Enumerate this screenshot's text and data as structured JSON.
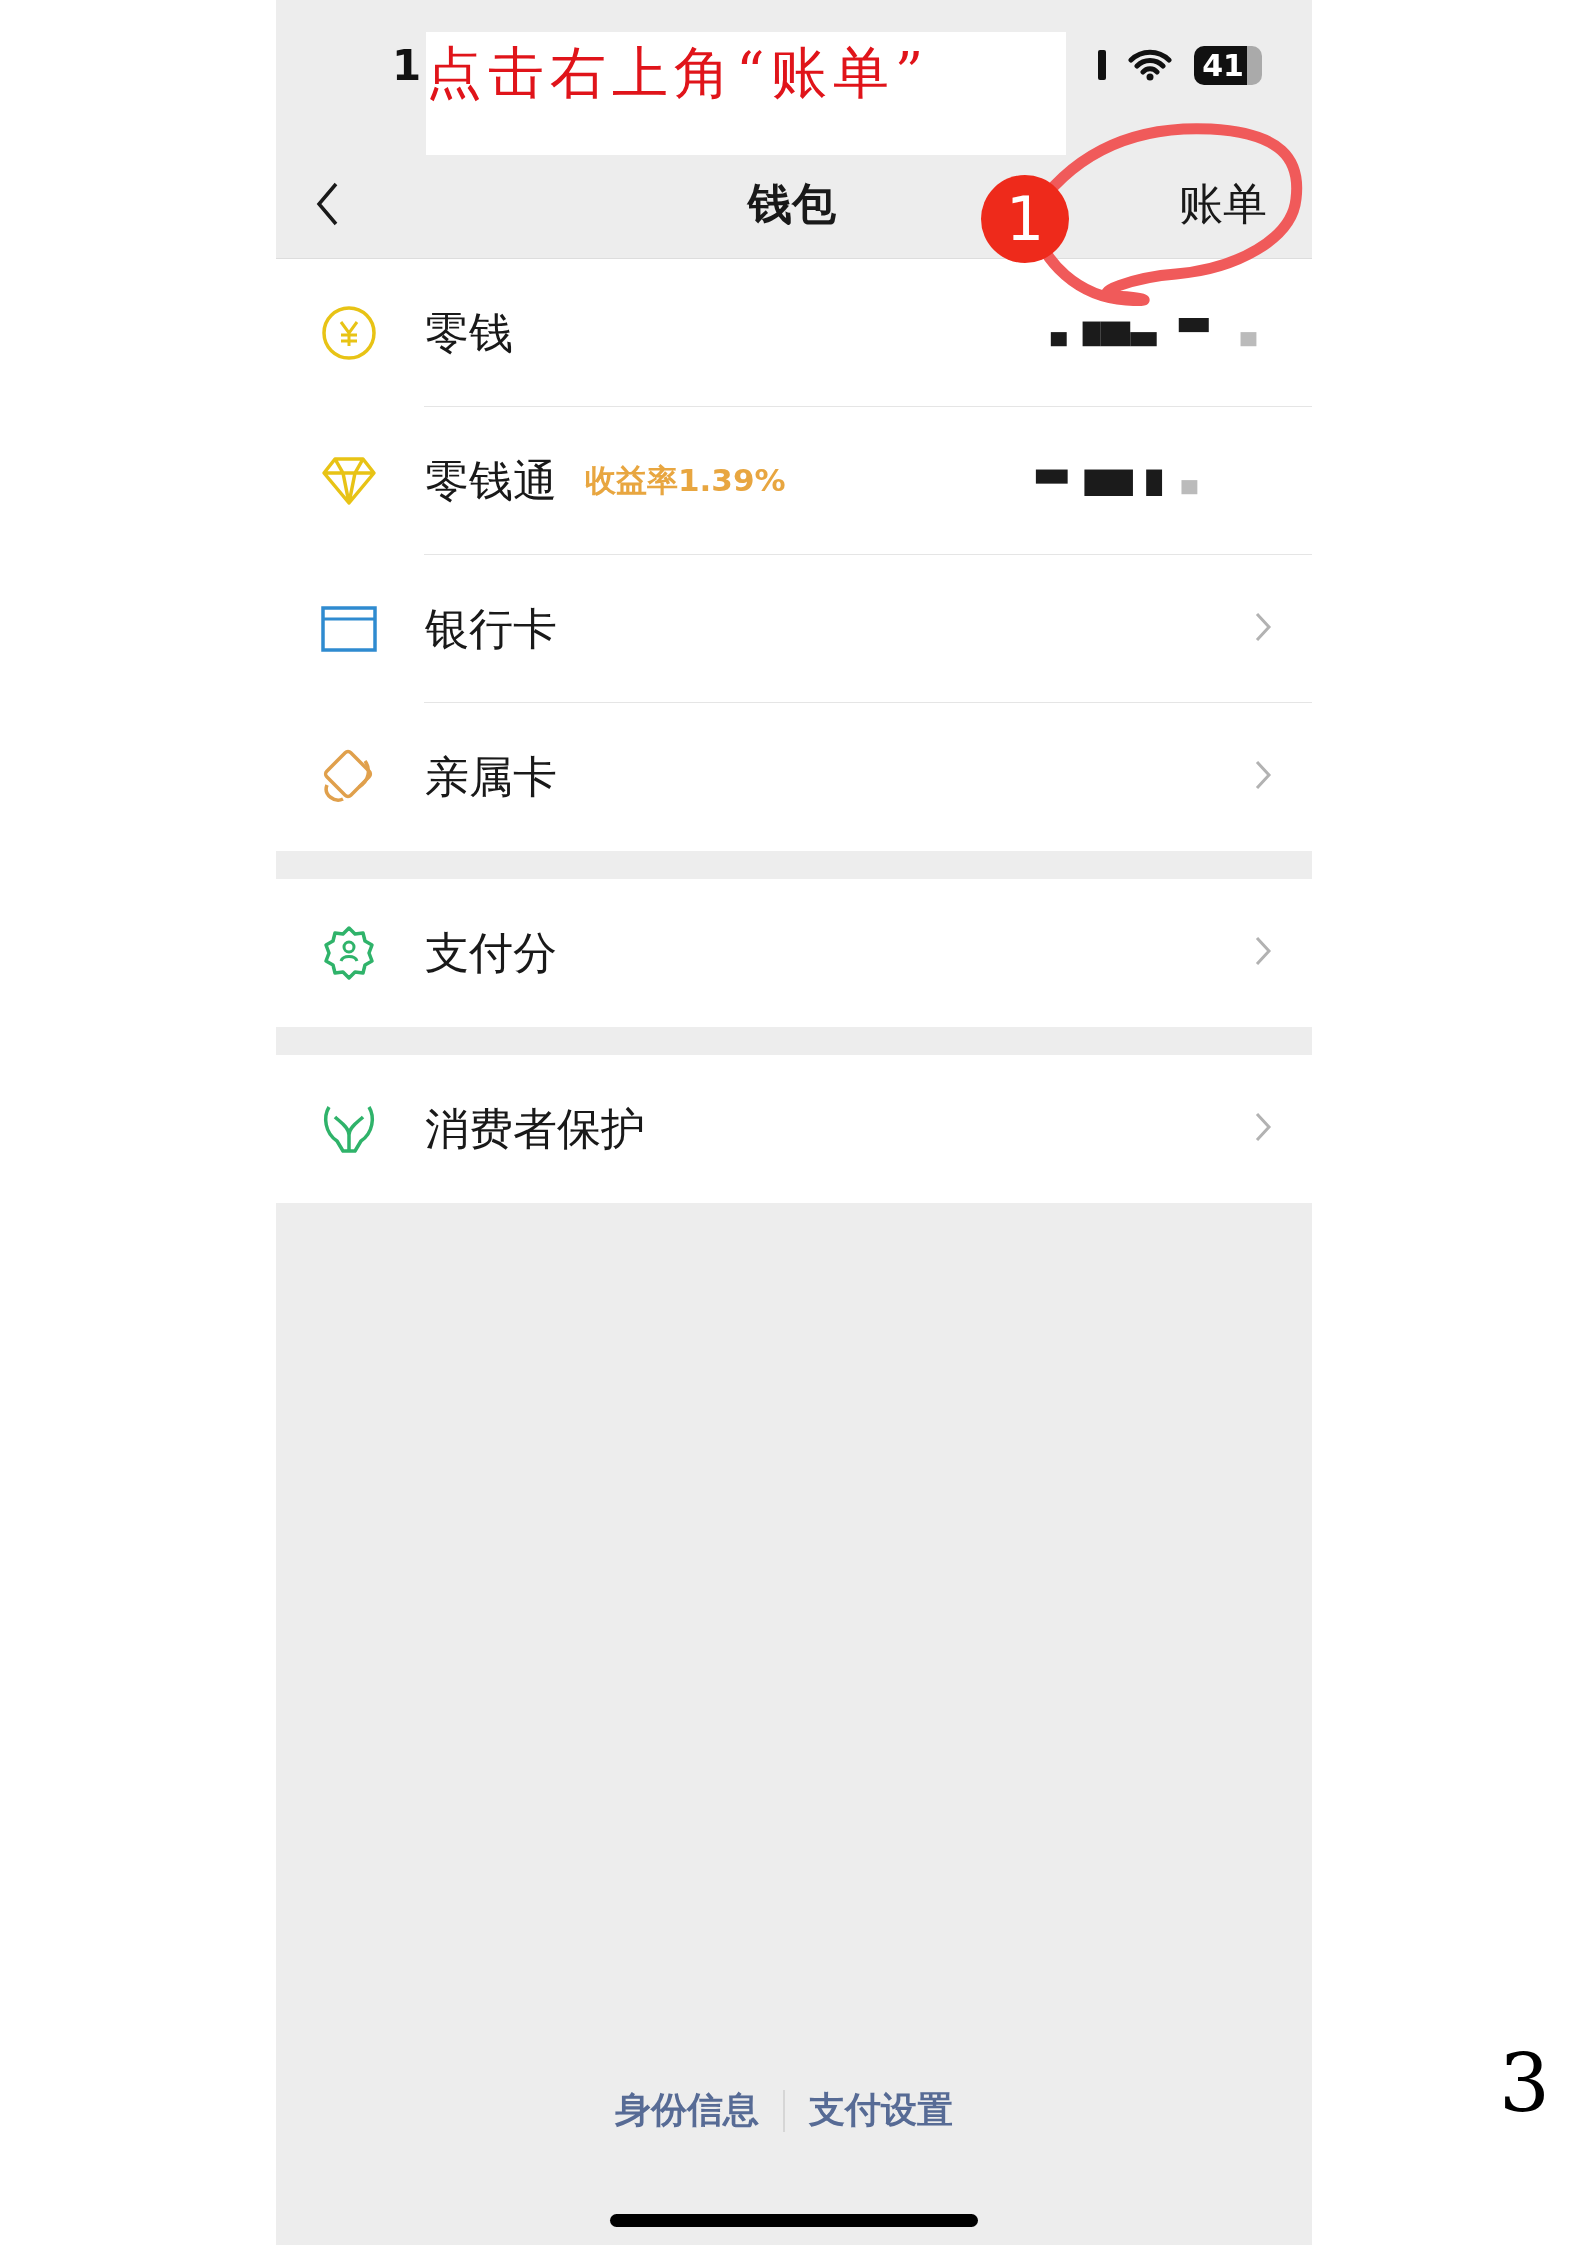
{
  "annotation": {
    "instruction": "点击右上角“账单”",
    "step_badge": "1"
  },
  "status_bar": {
    "time": "1",
    "battery": "41"
  },
  "nav_bar": {
    "title": "钱包",
    "action": "账单"
  },
  "sections": [
    {
      "items": [
        {
          "label": "零钱",
          "kind": "amount"
        },
        {
          "label": "零钱通",
          "tag": "收益率1.39%",
          "kind": "amount"
        },
        {
          "label": "银行卡",
          "kind": "link"
        },
        {
          "label": "亲属卡",
          "kind": "link"
        }
      ]
    },
    {
      "items": [
        {
          "label": "支付分",
          "kind": "link"
        }
      ]
    },
    {
      "items": [
        {
          "label": "消费者保护",
          "kind": "link"
        }
      ]
    }
  ],
  "footer_links": [
    "身份信息",
    "支付设置"
  ],
  "page_number": "3"
}
